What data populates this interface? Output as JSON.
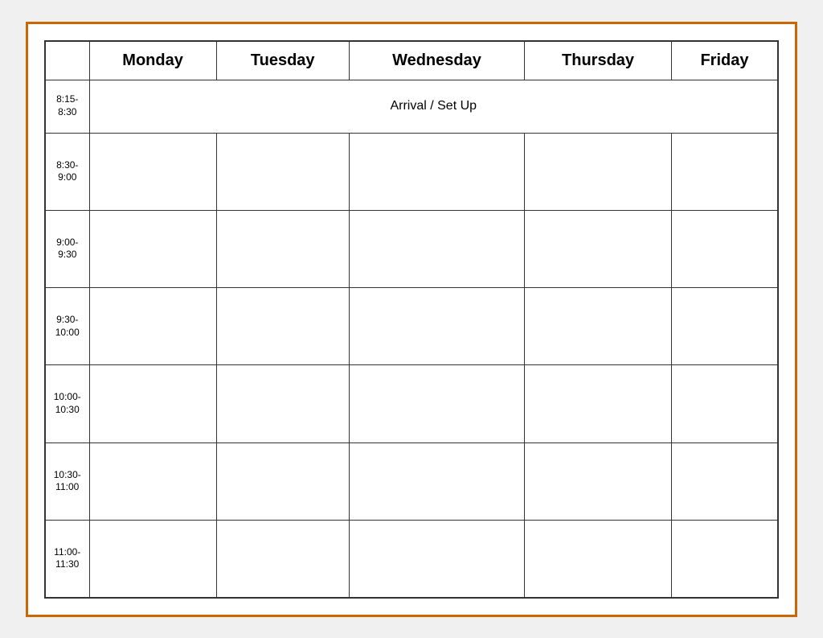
{
  "table": {
    "headers": {
      "time": "",
      "monday": "Monday",
      "tuesday": "Tuesday",
      "wednesday": "Wednesday",
      "thursday": "Thursday",
      "friday": "Friday"
    },
    "arrival_label": "Arrival / Set Up",
    "time_slots": [
      {
        "id": "slot-815",
        "label": "8:15-\n8:30"
      },
      {
        "id": "slot-830",
        "label": "8:30-\n9:00"
      },
      {
        "id": "slot-900",
        "label": "9:00-\n9:30"
      },
      {
        "id": "slot-930",
        "label": "9:30-\n10:00"
      },
      {
        "id": "slot-1000",
        "label": "10:00-\n10:30"
      },
      {
        "id": "slot-1030",
        "label": "10:30-\n11:00"
      },
      {
        "id": "slot-1100",
        "label": "11:00-\n11:30"
      }
    ]
  }
}
